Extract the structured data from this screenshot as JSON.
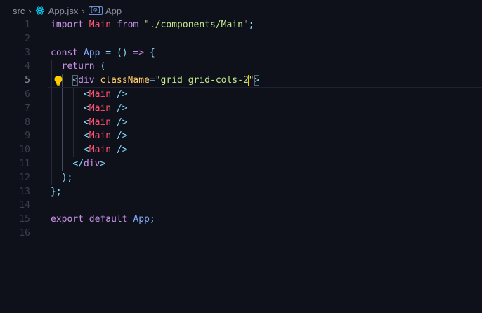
{
  "breadcrumb": {
    "folder": "src",
    "file": "App.jsx",
    "symbol": "App"
  },
  "icons": {
    "file_icon": "react-icon",
    "symbol_icon": "symbol-variable-icon",
    "lightbulb": "lightbulb-icon"
  },
  "colors": {
    "background": "#0f111a",
    "keyword": "#c792ea",
    "string": "#c3e88d",
    "identifier": "#ff5370",
    "punctuation": "#89ddff",
    "attribute": "#ffcb6b",
    "cursor": "#ffcc00"
  },
  "editor": {
    "current_line": 5,
    "lines": [
      {
        "n": "1",
        "tokens": [
          {
            "t": "import",
            "c": "kw"
          },
          {
            "t": " "
          },
          {
            "t": "Main",
            "c": "id"
          },
          {
            "t": " "
          },
          {
            "t": "from",
            "c": "kw"
          },
          {
            "t": " "
          },
          {
            "t": "\"./components/Main\"",
            "c": "str"
          },
          {
            "t": ";",
            "c": "punc"
          }
        ]
      },
      {
        "n": "2",
        "tokens": []
      },
      {
        "n": "3",
        "tokens": [
          {
            "t": "const",
            "c": "kw"
          },
          {
            "t": " "
          },
          {
            "t": "App",
            "c": "fn"
          },
          {
            "t": " "
          },
          {
            "t": "=",
            "c": "punc"
          },
          {
            "t": " "
          },
          {
            "t": "()",
            "c": "punc"
          },
          {
            "t": " "
          },
          {
            "t": "=>",
            "c": "kw"
          },
          {
            "t": " "
          },
          {
            "t": "{",
            "c": "punc"
          }
        ]
      },
      {
        "n": "4",
        "tokens": [
          {
            "t": "  "
          },
          {
            "t": "return",
            "c": "kw"
          },
          {
            "t": " "
          },
          {
            "t": "(",
            "c": "punc"
          }
        ]
      },
      {
        "n": "5",
        "tokens": [
          {
            "t": "    "
          },
          {
            "t": "<",
            "c": "punc",
            "box": true
          },
          {
            "t": "div",
            "c": "tag"
          },
          {
            "t": " "
          },
          {
            "t": "className",
            "c": "attr"
          },
          {
            "t": "=",
            "c": "punc"
          },
          {
            "t": "\"grid grid-cols-2",
            "c": "str"
          },
          {
            "cursor": true
          },
          {
            "t": "\"",
            "c": "str"
          },
          {
            "t": ">",
            "c": "punc",
            "box": true
          }
        ]
      },
      {
        "n": "6",
        "tokens": [
          {
            "t": "      "
          },
          {
            "t": "<",
            "c": "punc"
          },
          {
            "t": "Main",
            "c": "id"
          },
          {
            "t": " "
          },
          {
            "t": "/>",
            "c": "punc"
          }
        ]
      },
      {
        "n": "7",
        "tokens": [
          {
            "t": "      "
          },
          {
            "t": "<",
            "c": "punc"
          },
          {
            "t": "Main",
            "c": "id"
          },
          {
            "t": " "
          },
          {
            "t": "/>",
            "c": "punc"
          }
        ]
      },
      {
        "n": "8",
        "tokens": [
          {
            "t": "      "
          },
          {
            "t": "<",
            "c": "punc"
          },
          {
            "t": "Main",
            "c": "id"
          },
          {
            "t": " "
          },
          {
            "t": "/>",
            "c": "punc"
          }
        ]
      },
      {
        "n": "9",
        "tokens": [
          {
            "t": "      "
          },
          {
            "t": "<",
            "c": "punc"
          },
          {
            "t": "Main",
            "c": "id"
          },
          {
            "t": " "
          },
          {
            "t": "/>",
            "c": "punc"
          }
        ]
      },
      {
        "n": "10",
        "tokens": [
          {
            "t": "      "
          },
          {
            "t": "<",
            "c": "punc"
          },
          {
            "t": "Main",
            "c": "id"
          },
          {
            "t": " "
          },
          {
            "t": "/>",
            "c": "punc"
          }
        ]
      },
      {
        "n": "11",
        "tokens": [
          {
            "t": "    "
          },
          {
            "t": "</",
            "c": "punc"
          },
          {
            "t": "div",
            "c": "tag"
          },
          {
            "t": ">",
            "c": "punc"
          }
        ]
      },
      {
        "n": "12",
        "tokens": [
          {
            "t": "  "
          },
          {
            "t": ")",
            "c": "punc"
          },
          {
            "t": ";",
            "c": "punc"
          }
        ]
      },
      {
        "n": "13",
        "tokens": [
          {
            "t": "}",
            "c": "punc"
          },
          {
            "t": ";",
            "c": "punc"
          }
        ]
      },
      {
        "n": "14",
        "tokens": []
      },
      {
        "n": "15",
        "tokens": [
          {
            "t": "export",
            "c": "kw"
          },
          {
            "t": " "
          },
          {
            "t": "default",
            "c": "kw"
          },
          {
            "t": " "
          },
          {
            "t": "App",
            "c": "fn"
          },
          {
            "t": ";",
            "c": "punc"
          }
        ]
      },
      {
        "n": "16",
        "tokens": []
      }
    ]
  }
}
